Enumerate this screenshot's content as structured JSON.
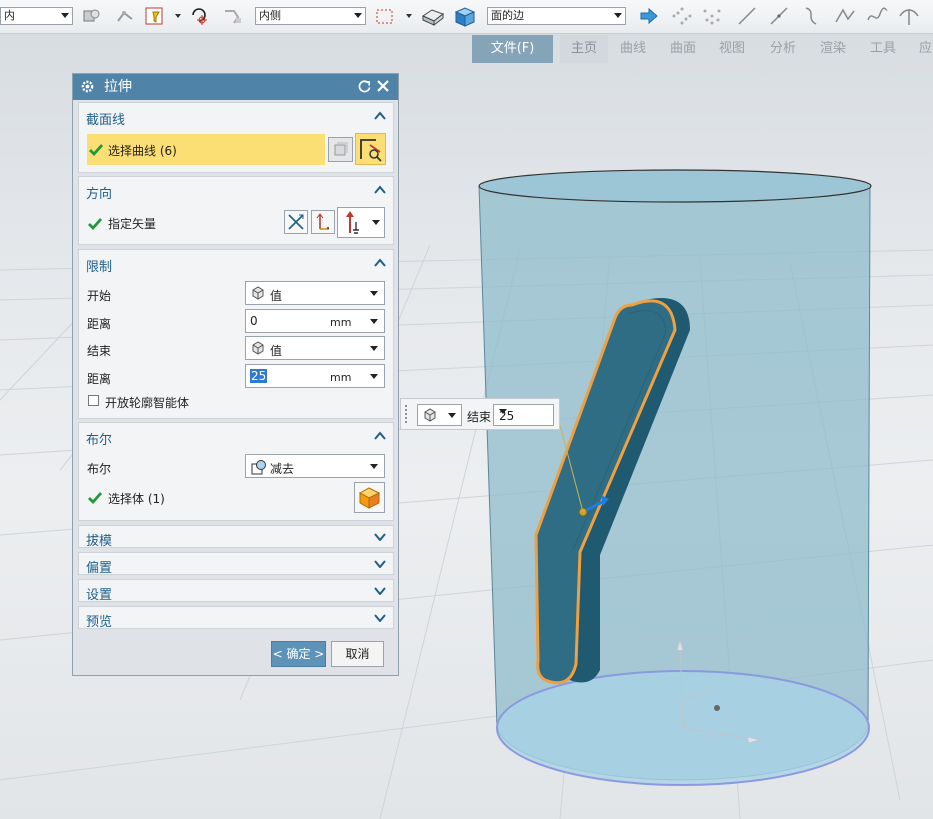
{
  "toolbar": {
    "filter_left": "内",
    "curve_rule": "内侧",
    "face_rule": "面的边"
  },
  "ribbon": {
    "tabs": [
      "文件(F)",
      "主页",
      "曲线",
      "曲面",
      "视图",
      "分析",
      "渲染",
      "工具",
      "应"
    ]
  },
  "dialog": {
    "title": "拉伸",
    "section": {
      "title": "截面线",
      "select_curve": "选择曲线 (6)"
    },
    "direction": {
      "title": "方向",
      "specify_vector": "指定矢量"
    },
    "limits": {
      "title": "限制",
      "start_label": "开始",
      "start_value": "值",
      "start_distance_label": "距离",
      "start_distance": "0",
      "start_unit": "mm",
      "end_label": "结束",
      "end_value": "值",
      "end_distance_label": "距离",
      "end_distance": "25",
      "end_unit": "mm",
      "open_profile": "开放轮廓智能体"
    },
    "boolean": {
      "title": "布尔",
      "label": "布尔",
      "value": "减去",
      "select_body": "选择体 (1)"
    },
    "draft": {
      "title": "拔模"
    },
    "offset": {
      "title": "偏置"
    },
    "settings": {
      "title": "设置"
    },
    "preview": {
      "title": "预览"
    },
    "ok": "< 确定 >",
    "cancel": "取消"
  },
  "float_widget": {
    "label": "结束",
    "value": "25"
  },
  "colors": {
    "title_bar": "#4f84a8",
    "selection_highlight": "#fbdf74",
    "section_title": "#1f5f8b",
    "body_fill": "#2f6d84",
    "curve_highlight": "#f0a040",
    "cylinder": "#9cc6d5"
  }
}
